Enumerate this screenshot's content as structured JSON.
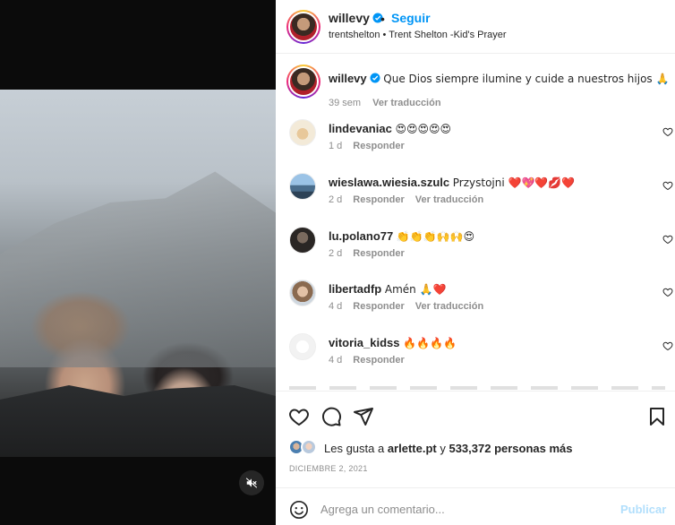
{
  "post": {
    "author": "willevy",
    "follow_label": "Seguir",
    "audio_line": "trentshelton • Trent Shelton -Kid's Prayer",
    "verified_color": "#0095f6"
  },
  "caption": {
    "username": "willevy",
    "text": "Que Dios siempre ilumine y cuide a nuestros hijos 🙏",
    "time": "39 sem",
    "translate": "Ver traducción"
  },
  "comments": [
    {
      "username": "lindevaniac",
      "text": "😍😍😍😍😍",
      "time": "1 d",
      "reply": "Responder",
      "translate": ""
    },
    {
      "username": "wieslawa.wiesia.szulc",
      "text": "Przystojni ❤️💖❤️💋❤️",
      "time": "2 d",
      "reply": "Responder",
      "translate": "Ver traducción"
    },
    {
      "username": "lu.polano77",
      "text": "👏👏👏🙌🙌😍",
      "time": "2 d",
      "reply": "Responder",
      "translate": ""
    },
    {
      "username": "libertadfp",
      "text": "Amén 🙏❤️",
      "time": "4 d",
      "reply": "Responder",
      "translate": "Ver traducción"
    },
    {
      "username": "vitoria_kidss",
      "text": "🔥🔥🔥🔥",
      "time": "4 d",
      "reply": "Responder",
      "translate": ""
    }
  ],
  "likes": {
    "prefix": "Les gusta a ",
    "user": "arlette.pt",
    "middle": " y ",
    "count": "533,372 personas más"
  },
  "date": "DICIEMBRE 2, 2021",
  "comment_box": {
    "placeholder": "Agrega un comentario...",
    "post_label": "Publicar"
  },
  "icons": {
    "like": "heart-outline-icon",
    "comment": "speech-bubble-icon",
    "share": "paper-plane-icon",
    "save": "bookmark-icon",
    "mute": "speaker-muted-icon",
    "emoji": "smiley-icon"
  }
}
